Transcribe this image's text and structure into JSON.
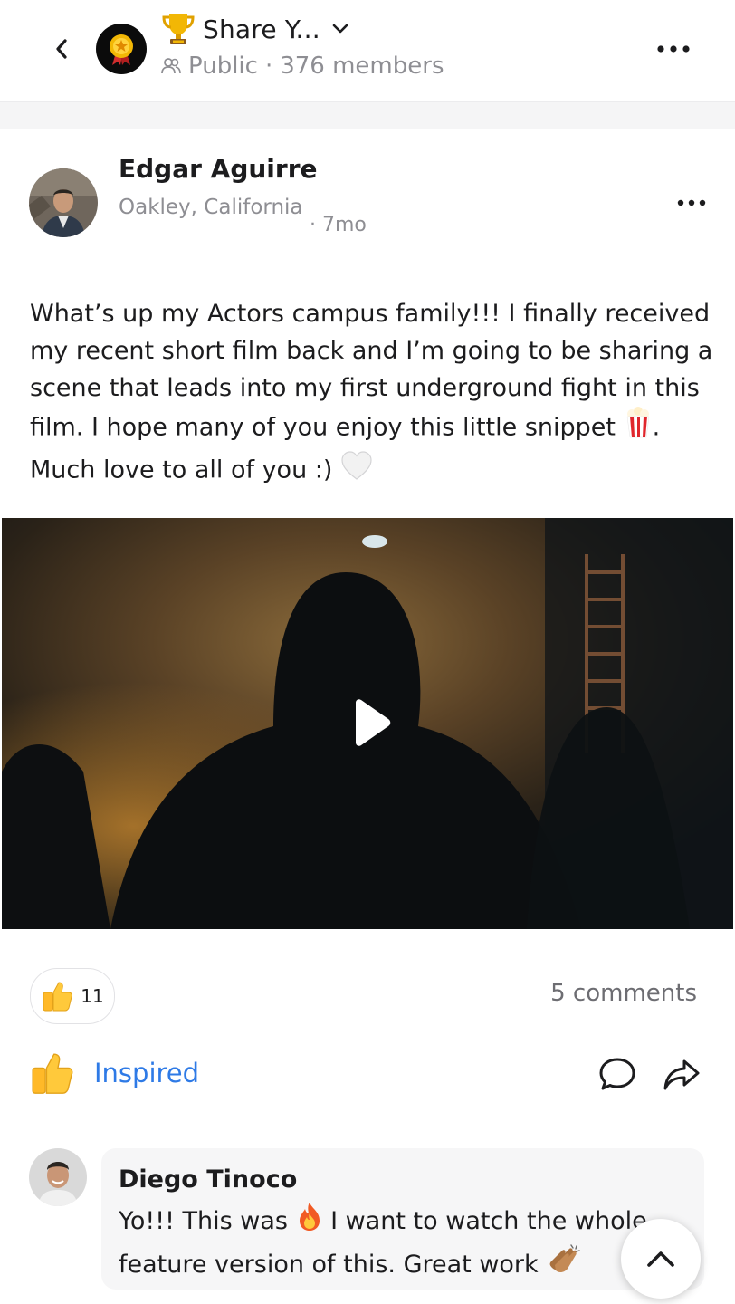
{
  "header": {
    "group_title": "Share Y...",
    "visibility": "Public",
    "separator": "·",
    "members": "376 members"
  },
  "post": {
    "author_name": "Edgar Aguirre",
    "author_location": "Oakley, California",
    "time": "· 7mo",
    "text_main": "What’s up my Actors campus family!!! I finally received my recent short film back and I’m going to be sharing a scene that leads into my first underground fight in this film. I hope many of you enjoy this little snippet ",
    "text_after_popcorn": ".",
    "text_line_end": "Much love to all of you :) ",
    "reaction_count": "11",
    "comments_count": "5 comments",
    "reaction_label": "Inspired"
  },
  "comment": {
    "name": "Diego Tinoco",
    "text_part1": "Yo!!! This was ",
    "text_part2": " I want to watch the whole feature version of this. Great work "
  },
  "icons": {
    "back": "chevron-left-icon",
    "more": "more-horizontal-icon",
    "trophy": "trophy-icon",
    "members": "members-icon",
    "play": "play-icon",
    "thumbs_up": "thumbs-up-icon",
    "comment": "comment-icon",
    "share": "share-icon",
    "scroll_top": "chevron-up-icon"
  },
  "colors": {
    "accent": "#2e7ae6",
    "muted": "#8e8e93",
    "text": "#1c1c1e"
  }
}
